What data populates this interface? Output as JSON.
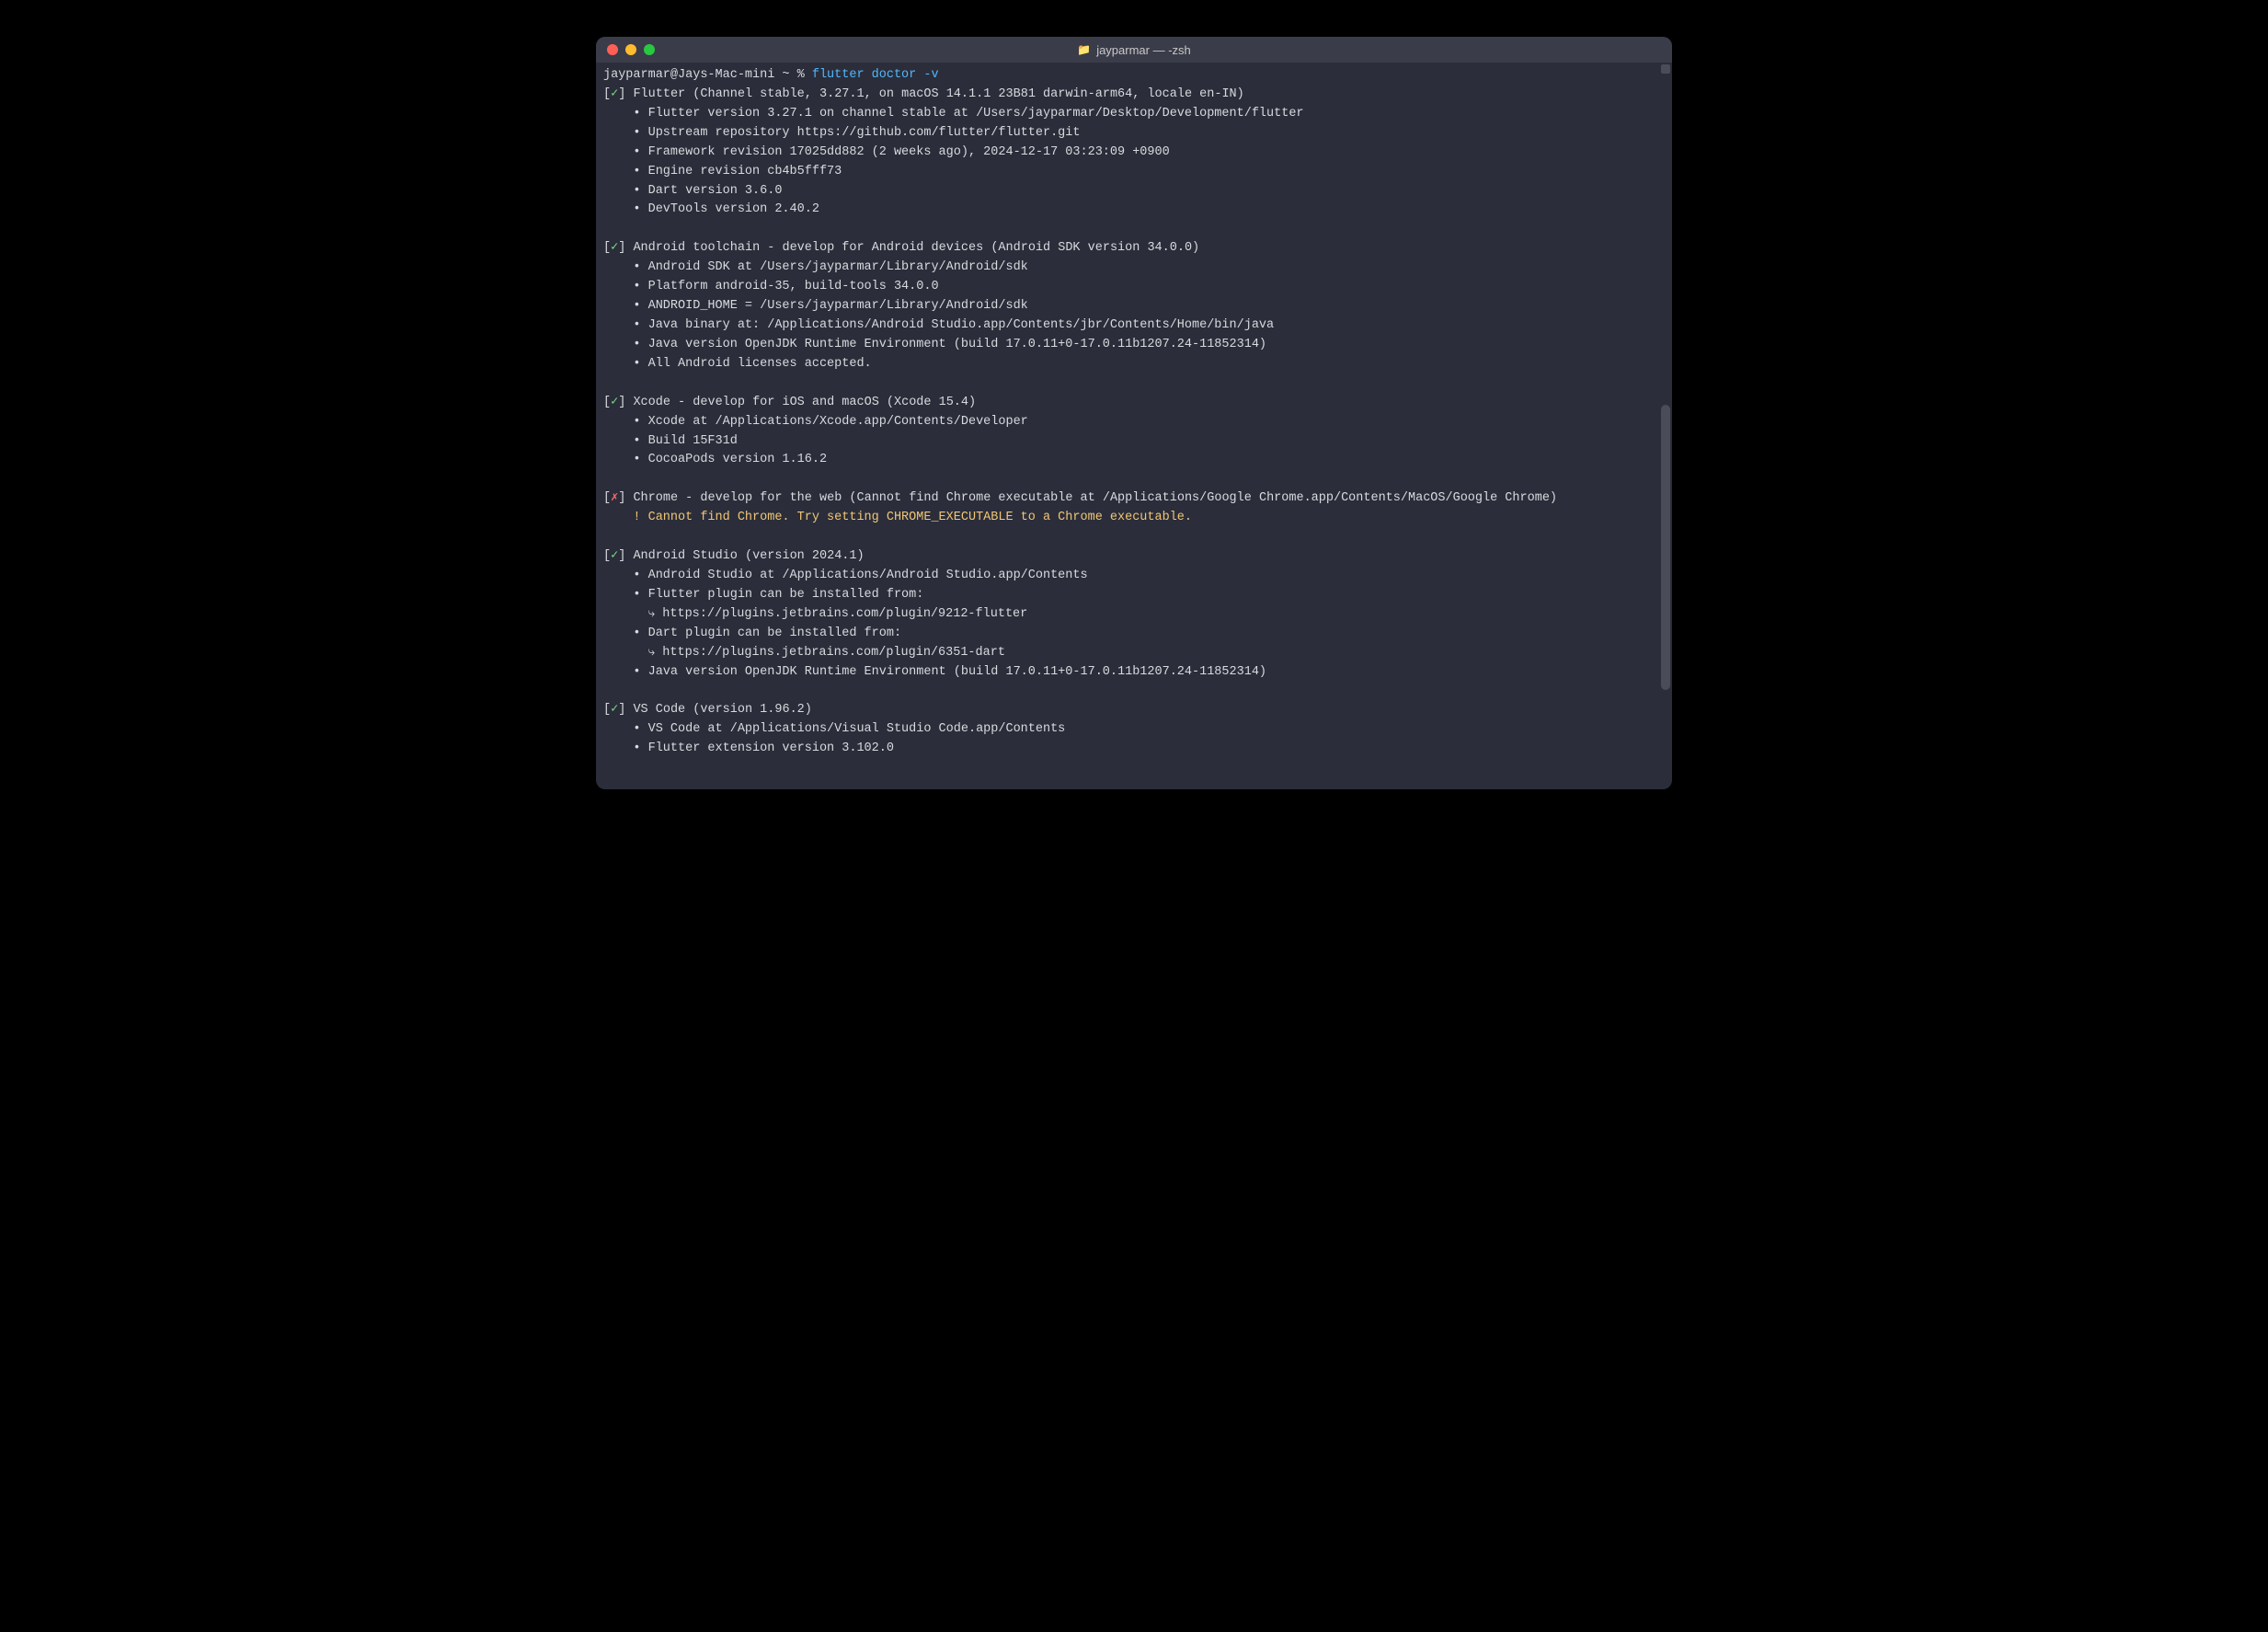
{
  "window": {
    "title": "jayparmar — -zsh"
  },
  "prompt": {
    "userhost": "jayparmar@Jays-Mac-mini ~ % ",
    "command": "flutter doctor -v"
  },
  "sections": [
    {
      "status": "ok",
      "title": "Flutter (Channel stable, 3.27.1, on macOS 14.1.1 23B81 darwin-arm64, locale en-IN)",
      "items": [
        {
          "type": "bullet",
          "text": "Flutter version 3.27.1 on channel stable at /Users/jayparmar/Desktop/Development/flutter"
        },
        {
          "type": "bullet",
          "text": "Upstream repository https://github.com/flutter/flutter.git"
        },
        {
          "type": "bullet",
          "text": "Framework revision 17025dd882 (2 weeks ago), 2024-12-17 03:23:09 +0900"
        },
        {
          "type": "bullet",
          "text": "Engine revision cb4b5fff73"
        },
        {
          "type": "bullet",
          "text": "Dart version 3.6.0"
        },
        {
          "type": "bullet",
          "text": "DevTools version 2.40.2"
        }
      ]
    },
    {
      "status": "ok",
      "title": "Android toolchain - develop for Android devices (Android SDK version 34.0.0)",
      "items": [
        {
          "type": "bullet",
          "text": "Android SDK at /Users/jayparmar/Library/Android/sdk"
        },
        {
          "type": "bullet",
          "text": "Platform android-35, build-tools 34.0.0"
        },
        {
          "type": "bullet",
          "text": "ANDROID_HOME = /Users/jayparmar/Library/Android/sdk"
        },
        {
          "type": "bullet",
          "text": "Java binary at: /Applications/Android Studio.app/Contents/jbr/Contents/Home/bin/java"
        },
        {
          "type": "bullet",
          "text": "Java version OpenJDK Runtime Environment (build 17.0.11+0-17.0.11b1207.24-11852314)"
        },
        {
          "type": "bullet",
          "text": "All Android licenses accepted."
        }
      ]
    },
    {
      "status": "ok",
      "title": "Xcode - develop for iOS and macOS (Xcode 15.4)",
      "items": [
        {
          "type": "bullet",
          "text": "Xcode at /Applications/Xcode.app/Contents/Developer"
        },
        {
          "type": "bullet",
          "text": "Build 15F31d"
        },
        {
          "type": "bullet",
          "text": "CocoaPods version 1.16.2"
        }
      ]
    },
    {
      "status": "fail",
      "title": "Chrome - develop for the web (Cannot find Chrome executable at /Applications/Google Chrome.app/Contents/MacOS/Google Chrome)",
      "items": [
        {
          "type": "warn",
          "text": "Cannot find Chrome. Try setting CHROME_EXECUTABLE to a Chrome executable."
        }
      ]
    },
    {
      "status": "ok",
      "title": "Android Studio (version 2024.1)",
      "items": [
        {
          "type": "bullet",
          "text": "Android Studio at /Applications/Android Studio.app/Contents"
        },
        {
          "type": "bullet",
          "text": "Flutter plugin can be installed from:"
        },
        {
          "type": "link",
          "text": "https://plugins.jetbrains.com/plugin/9212-flutter"
        },
        {
          "type": "bullet",
          "text": "Dart plugin can be installed from:"
        },
        {
          "type": "link",
          "text": "https://plugins.jetbrains.com/plugin/6351-dart"
        },
        {
          "type": "bullet",
          "text": "Java version OpenJDK Runtime Environment (build 17.0.11+0-17.0.11b1207.24-11852314)"
        }
      ]
    },
    {
      "status": "ok",
      "title": "VS Code (version 1.96.2)",
      "items": [
        {
          "type": "bullet",
          "text": "VS Code at /Applications/Visual Studio Code.app/Contents"
        },
        {
          "type": "bullet",
          "text": "Flutter extension version 3.102.0"
        }
      ]
    }
  ],
  "glyphs": {
    "check": "✓",
    "cross": "✗",
    "bullet": "•",
    "warn": "!",
    "link": "🔨"
  }
}
